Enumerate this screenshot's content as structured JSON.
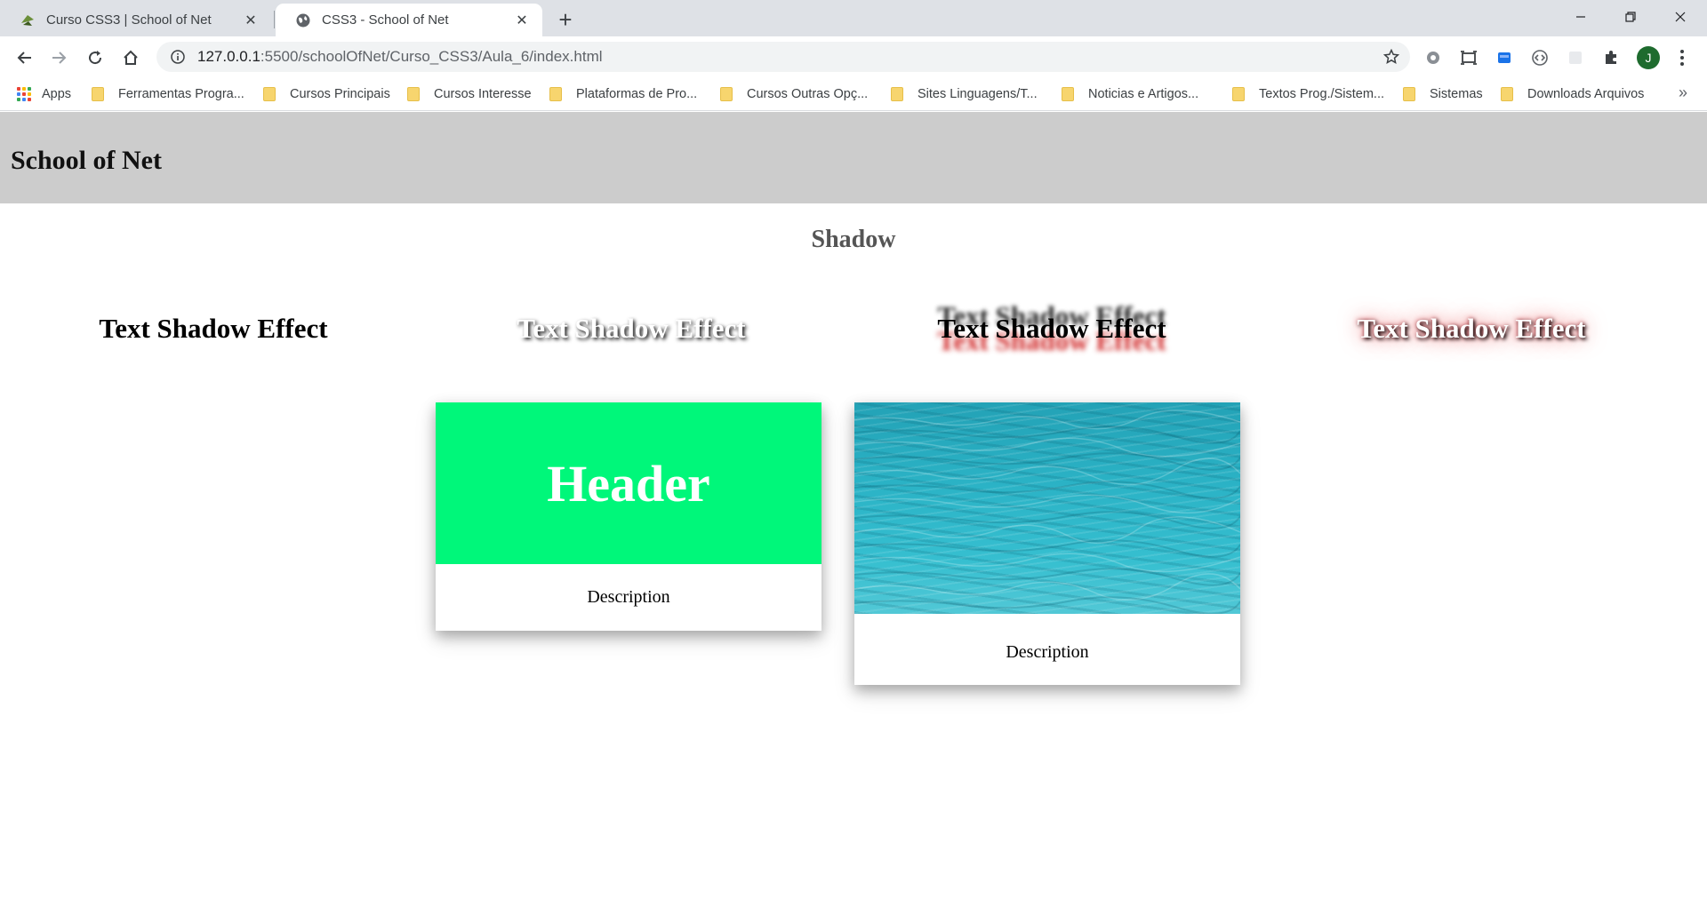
{
  "browser": {
    "tabs": [
      {
        "title": "Curso CSS3 | School of Net",
        "active": false
      },
      {
        "title": "CSS3 - School of Net",
        "active": true
      }
    ],
    "address": {
      "host": "127.0.0.1",
      "rest": ":5500/schoolOfNet/Curso_CSS3/Aula_6/index.html"
    },
    "profile_initial": "J",
    "bookmarks": [
      {
        "label": "Apps",
        "icon": "apps-grid-icon"
      },
      {
        "label": "Ferramentas Progra...",
        "icon": "folder-icon"
      },
      {
        "label": "Cursos Principais",
        "icon": "folder-icon"
      },
      {
        "label": "Cursos Interesse",
        "icon": "folder-icon"
      },
      {
        "label": "Plataformas de Pro...",
        "icon": "folder-icon"
      },
      {
        "label": "Cursos Outras Opç...",
        "icon": "folder-icon"
      },
      {
        "label": "Sites Linguagens/T...",
        "icon": "folder-icon"
      },
      {
        "label": "Noticias e Artigos...",
        "icon": "folder-icon"
      },
      {
        "label": "Textos Prog./Sistem...",
        "icon": "folder-icon"
      },
      {
        "label": "Sistemas",
        "icon": "folder-icon"
      },
      {
        "label": "Downloads Arquivos",
        "icon": "folder-icon"
      }
    ],
    "bookmarks_overflow": "»"
  },
  "page": {
    "site_title": "School of Net",
    "section_title": "Shadow",
    "text_shadow_samples": [
      "Text Shadow Effect",
      "Text Shadow Effect",
      "Text Shadow Effect",
      "Text Shadow Effect"
    ],
    "cards": [
      {
        "header": "Header",
        "description": "Description",
        "header_color": "#00f77a"
      },
      {
        "image": "water-image",
        "description": "Description"
      }
    ]
  }
}
